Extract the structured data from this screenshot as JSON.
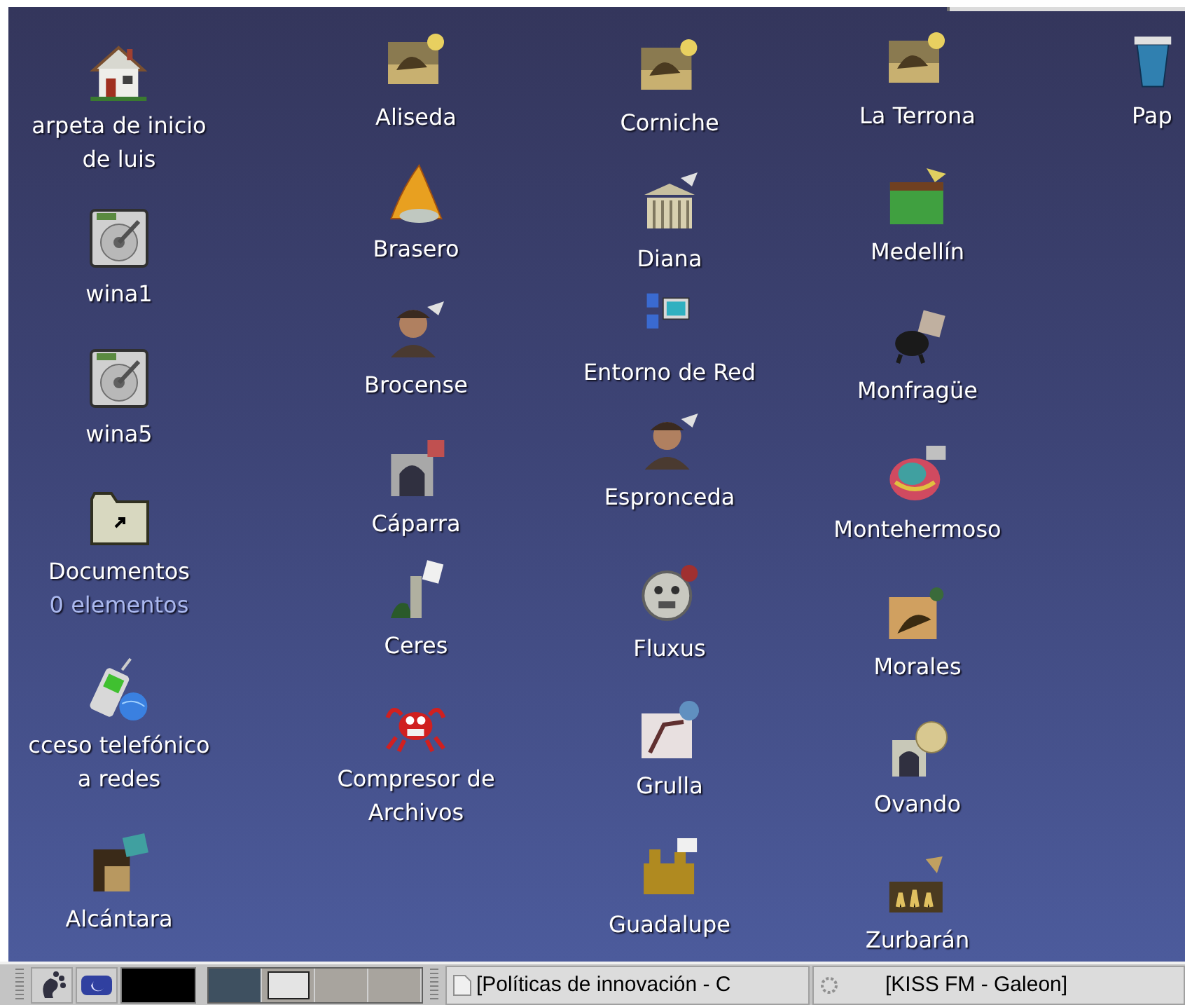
{
  "desktop": {
    "icons": [
      {
        "label": "arpeta de inicio\nde luis"
      },
      {
        "label": "wina1"
      },
      {
        "label": "wina5"
      },
      {
        "label": "Documentos",
        "detail": "0 elementos"
      },
      {
        "label": "cceso telefónico\na redes"
      },
      {
        "label": "Alcántara"
      },
      {
        "label": "Aliseda"
      },
      {
        "label": "Brasero"
      },
      {
        "label": "Brocense"
      },
      {
        "label": "Cáparra"
      },
      {
        "label": "Ceres"
      },
      {
        "label": "Compresor de\nArchivos"
      },
      {
        "label": "Corniche"
      },
      {
        "label": "Diana"
      },
      {
        "label": "Entorno de Red"
      },
      {
        "label": "Espronceda"
      },
      {
        "label": "Fluxus"
      },
      {
        "label": "Grulla"
      },
      {
        "label": "Guadalupe"
      },
      {
        "label": "La Terrona"
      },
      {
        "label": "Medellín"
      },
      {
        "label": "Monfragüe"
      },
      {
        "label": "Montehermoso"
      },
      {
        "label": "Morales"
      },
      {
        "label": "Ovando"
      },
      {
        "label": "Zurbarán"
      },
      {
        "label": "Pap"
      }
    ]
  },
  "taskbar": {
    "workspaces": [
      {
        "selected": true
      },
      {
        "selected": false
      },
      {
        "selected": false
      },
      {
        "selected": false
      }
    ],
    "tasks": [
      {
        "label": "[Políticas de innovación - C"
      },
      {
        "label": "[KISS FM - Galeon]"
      }
    ]
  }
}
